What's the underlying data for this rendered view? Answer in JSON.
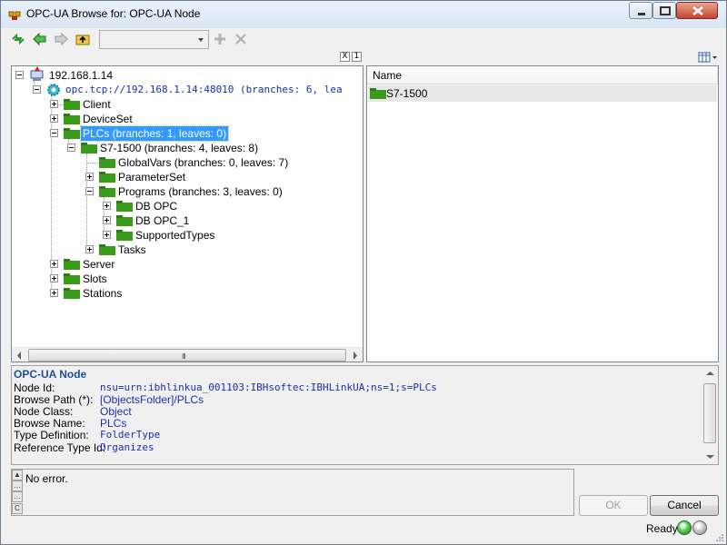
{
  "window": {
    "title": "OPC-UA Browse for: OPC-UA Node"
  },
  "toolbar": {
    "icons": [
      "refresh-icon",
      "back-arrow-icon",
      "forward-arrow-icon",
      "folder-up-icon",
      "add-icon",
      "delete-icon"
    ],
    "combo_value": ""
  },
  "tree": {
    "root": {
      "label": "192.168.1.14"
    },
    "server": {
      "label": "opc.tcp://192.168.1.14:48010 (branches: 6, lea"
    },
    "nodes": {
      "client": "Client",
      "deviceset": "DeviceSet",
      "plcs": "PLCs (branches: 1, leaves: 0)",
      "s71500": "S7-1500 (branches: 4, leaves: 8)",
      "globalvars": "GlobalVars (branches: 0, leaves: 7)",
      "parameterset": "ParameterSet",
      "programs": "Programs (branches: 3, leaves: 0)",
      "dbopc": "DB OPC",
      "dbopc1": "DB OPC_1",
      "supportedtypes": "SupportedTypes",
      "tasks": "Tasks",
      "server": "Server",
      "slots": "Slots",
      "stations": "Stations"
    },
    "scroll_grip": "III"
  },
  "list": {
    "column_name": "Name",
    "rows": [
      "S7-1500"
    ]
  },
  "info": {
    "title": "OPC-UA Node",
    "rows": [
      {
        "key": "Node Id:",
        "value": "nsu=urn:ibhlinkua_001103:IBHsoftec:IBHLinkUA;ns=1;s=PLCs"
      },
      {
        "key": "Browse Path (*):",
        "value": "[ObjectsFolder]/PLCs"
      },
      {
        "key": "Node Class:",
        "value": "Object"
      },
      {
        "key": "Browse Name:",
        "value": "PLCs"
      },
      {
        "key": "Type Definition:",
        "value": "FolderType"
      },
      {
        "key": "Reference Type Id:",
        "value": "Organizes"
      }
    ]
  },
  "log": {
    "text": "No error.",
    "side_buttons": [
      "▲",
      "…",
      "…",
      "C"
    ]
  },
  "buttons": {
    "ok": "OK",
    "cancel": "Cancel"
  },
  "status": {
    "text": "Ready",
    "led_on_color": "#3cb93c",
    "led_off_color": "#a8a8a8"
  },
  "colors": {
    "selection": "#3399ff",
    "folder": "#3a9a1a",
    "link_text": "#1a2fb0",
    "info_title": "#1f4e99"
  },
  "pane_toggles": [
    "X",
    "1"
  ]
}
